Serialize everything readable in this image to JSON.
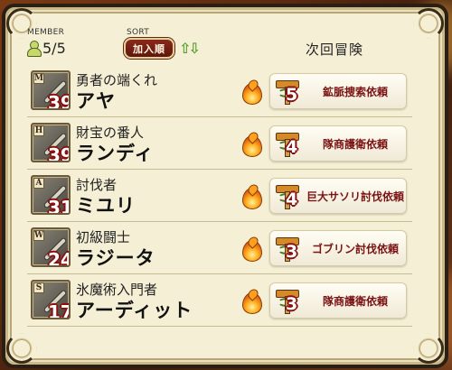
{
  "header": {
    "member_label": "MEMBER",
    "member_count": "5/5",
    "sort_label": "SORT",
    "sort_button": "加入順",
    "sort_arrows": "⇧⇩",
    "next_adventure_title": "次回冒険"
  },
  "members": [
    {
      "rank": "M",
      "level": "39",
      "title": "勇者の端くれ",
      "name": "アヤ",
      "quest_number": "5",
      "quest_name": "鉱脈捜索依頼"
    },
    {
      "rank": "H",
      "level": "39",
      "title": "財宝の番人",
      "name": "ランディ",
      "quest_number": "4",
      "quest_name": "隊商護衛依頼"
    },
    {
      "rank": "A",
      "level": "31",
      "title": "討伐者",
      "name": "ミユリ",
      "quest_number": "4",
      "quest_name": "巨大サソリ討伐依頼"
    },
    {
      "rank": "W",
      "level": "24",
      "title": "初級闘士",
      "name": "ラジータ",
      "quest_number": "3",
      "quest_name": "ゴブリン討伐依頼"
    },
    {
      "rank": "S",
      "level": "17",
      "title": "氷魔術入門者",
      "name": "アーディット",
      "quest_number": "3",
      "quest_name": "隊商護衛依頼"
    }
  ],
  "colors": {
    "panel_bg": "#f5f0d5",
    "sort_button_bg": "#7a2216",
    "quest_text": "#7a1414",
    "level_outline": "#8a1010",
    "arrow_green": "#5aa02c"
  },
  "icons": {
    "member": "person-icon",
    "sort": "sort-arrows-icon",
    "fire": "fire-icon",
    "quest": "quest-banner-icon"
  }
}
